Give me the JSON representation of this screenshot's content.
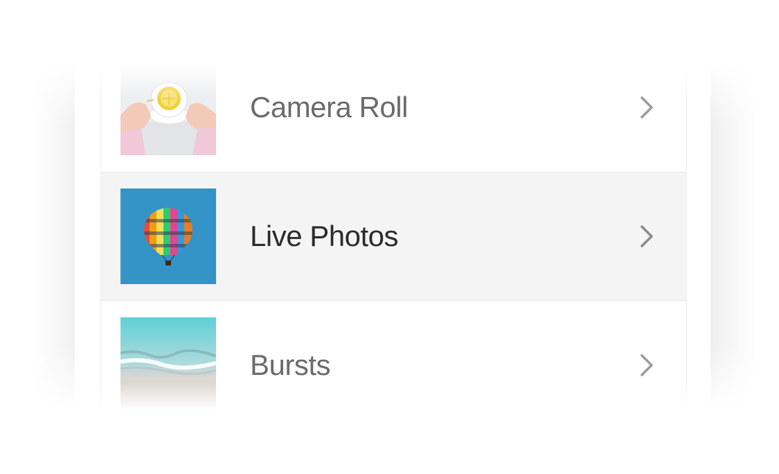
{
  "list": {
    "items": [
      {
        "label": "Camera Roll",
        "thumbnail": "tea-cup-photo",
        "selected": false
      },
      {
        "label": "Live Photos",
        "thumbnail": "hot-air-balloon-photo",
        "selected": true
      },
      {
        "label": "Bursts",
        "thumbnail": "beach-wave-photo",
        "selected": false
      }
    ],
    "chevron_icon": "chevron-right-icon"
  },
  "colors": {
    "background": "#ffffff",
    "selected_row": "#f4f4f4",
    "label_text": "#6b6b6b",
    "selected_label_text": "#2b2b2b",
    "chevron": "#9a9a9a"
  }
}
